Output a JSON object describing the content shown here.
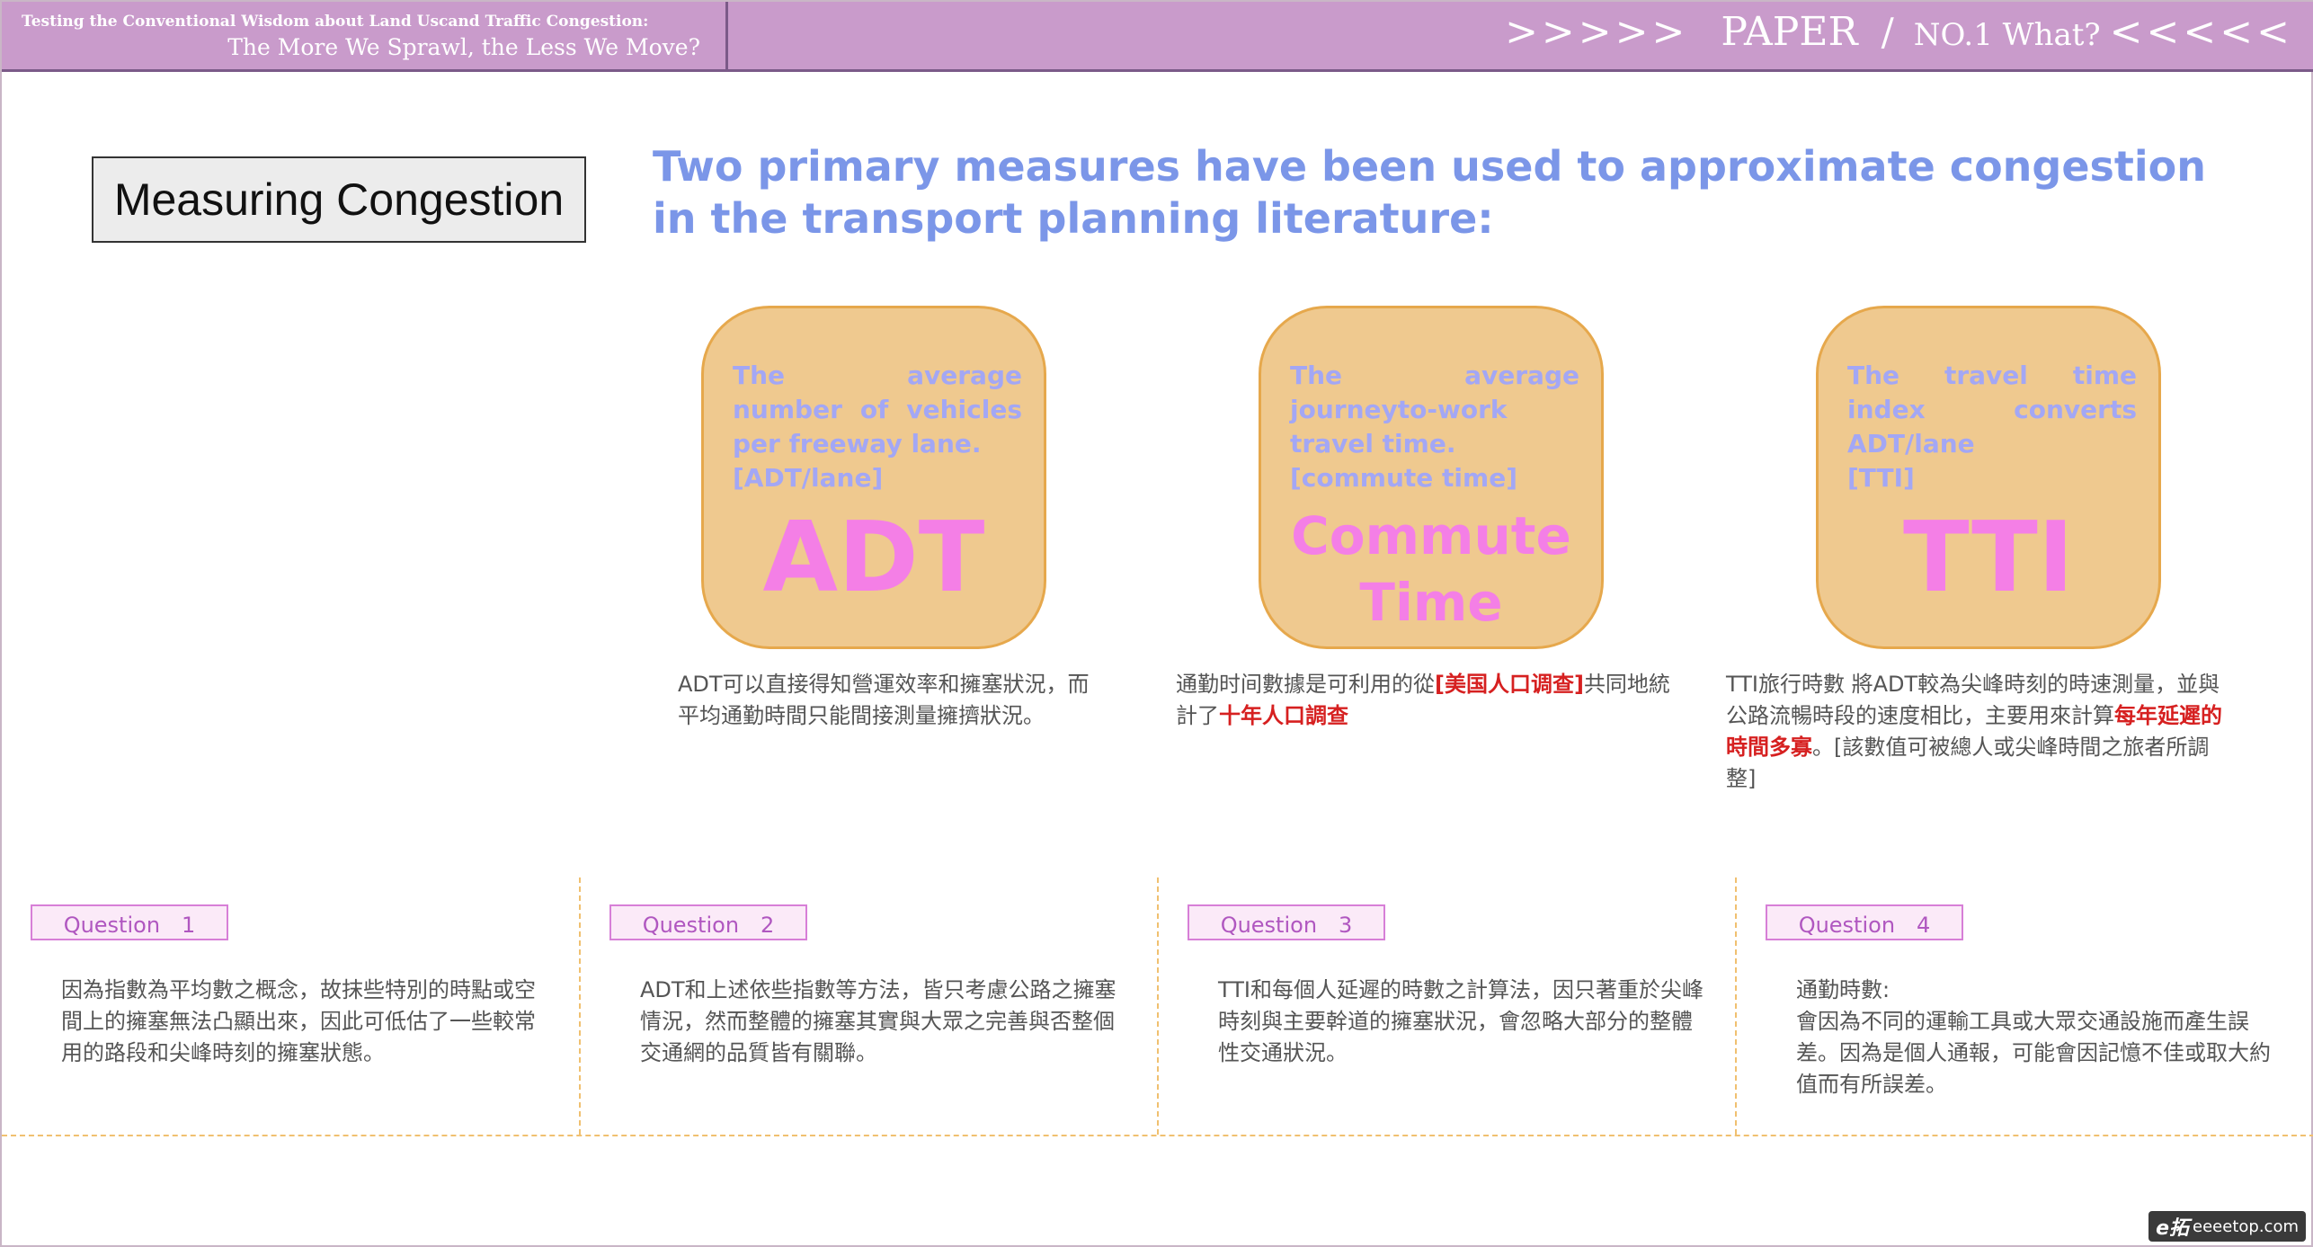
{
  "header": {
    "left_line1": "Testing the Conventional Wisdom about Land Uscand Traffic Congestion:",
    "left_line2": "The More We Sprawl, the Less We Move?",
    "arrows_left": ">>>>>",
    "paper": "PAPER",
    "slash": "/",
    "no": "NO.1 What?",
    "arrows_right": "<<<<<"
  },
  "title": "Measuring Congestion",
  "headline": "Two primary measures have been used to approximate congestion in the transport planning literature:",
  "cards": [
    {
      "desc": "The average number of vehicles per freeway lane.",
      "tag": "[ADT/lane]",
      "acronym": "ADT"
    },
    {
      "desc": "The average journeyto-work travel time.",
      "tag": "[commute time]",
      "acronym_line1": "Commute",
      "acronym_line2": "Time"
    },
    {
      "desc": "The travel time index converts ADT/lane",
      "tag": "[TTI]",
      "acronym": "TTI"
    }
  ],
  "notes": {
    "adt": "ADT可以直接得知營運效率和擁塞狀況，而平均通勤時間只能間接測量擁擠狀況。",
    "commute_a": "通勤时间數據是可利用的從",
    "commute_red1": "[美国人口调查]",
    "commute_b": "共同地統計了",
    "commute_red2": "十年人口調查",
    "tti_a": "TTI旅行時數 將ADT較為尖峰時刻的時速測量，並與公路流暢時段的速度相比，主要用來計算",
    "tti_red": "每年延遲的時間多寡",
    "tti_b": "。[該數值可被總人或尖峰時間之旅者所調整]"
  },
  "questions": [
    {
      "label": "Question　1",
      "text": "因為指數為平均數之概念，故抹些特別的時點或空間上的擁塞無法凸顯出來，因此可低估了一些較常用的路段和尖峰時刻的擁塞狀態。"
    },
    {
      "label": "Question　2",
      "text": "ADT和上述依些指數等方法，皆只考慮公路之擁塞情況，然而整體的擁塞其實與大眾之完善與否整個交通網的品質皆有關聯。"
    },
    {
      "label": "Question　3",
      "text": "TTI和每個人延遲的時數之計算法，因只著重於尖峰時刻與主要幹道的擁塞狀況，會忽略大部分的整體性交通狀況。"
    },
    {
      "label": "Question　4",
      "title": "通勤時數:",
      "text": "會因為不同的運輸工具或大眾交通設施而產生誤差。因為是個人通報，可能會因記憶不佳或取大約值而有所誤差。"
    }
  ],
  "watermark": {
    "mark": "e拓",
    "site": "eeeetop.com"
  }
}
